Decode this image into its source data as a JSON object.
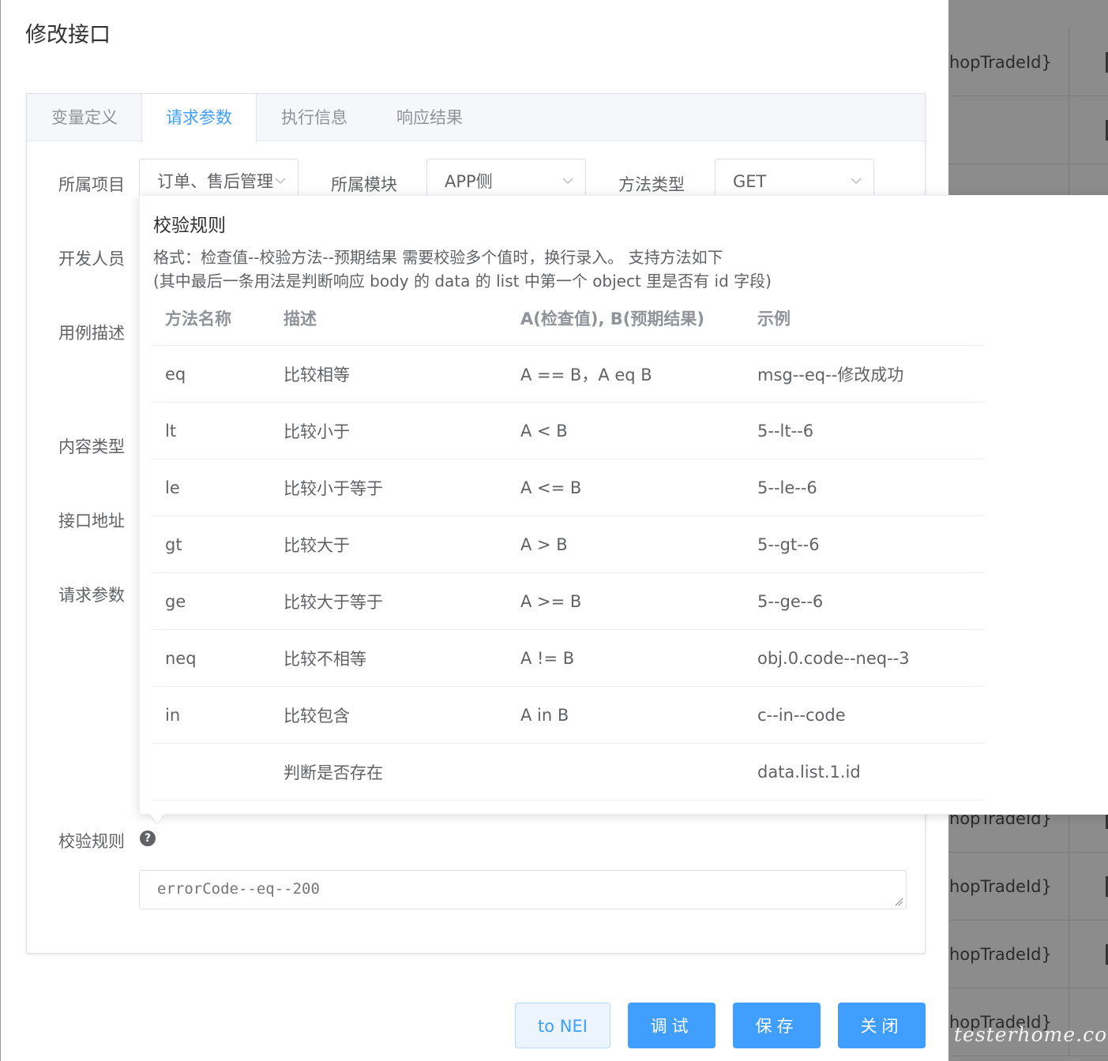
{
  "dialog": {
    "title": "修改接口",
    "tabs": [
      "变量定义",
      "请求参数",
      "执行信息",
      "响应结果"
    ],
    "active_tab": "请求参数"
  },
  "form": {
    "project_label": "所属项目",
    "project_value": "订单、售后管理",
    "module_label": "所属模块",
    "module_value": "APP侧",
    "method_label": "方法类型",
    "method_value": "GET",
    "developer_label": "开发人员",
    "case_desc_label": "用例描述",
    "content_type_label": "内容类型",
    "url_label": "接口地址",
    "params_label": "请求参数",
    "rules_label": "校验规则",
    "rules_placeholder": "errorCode--eq--200"
  },
  "popover": {
    "title": "校验规则",
    "desc_line1": "格式：检查值--校验方法--预期结果 需要校验多个值时，换行录入。 支持方法如下",
    "desc_line2": "(其中最后一条用法是判断响应 body 的 data 的 list 中第一个 object 里是否有 id 字段)",
    "columns": [
      "方法名称",
      "描述",
      "A(检查值), B(预期结果)",
      "示例"
    ],
    "rows": [
      [
        "eq",
        "比较相等",
        "A == B，A eq B",
        "msg--eq--修改成功"
      ],
      [
        "lt",
        "比较小于",
        "A < B",
        "5--lt--6"
      ],
      [
        "le",
        "比较小于等于",
        "A <= B",
        "5--le--6"
      ],
      [
        "gt",
        "比较大于",
        "A > B",
        "5--gt--6"
      ],
      [
        "ge",
        "比较大于等于",
        "A >= B",
        "5--ge--6"
      ],
      [
        "neq",
        "比较不相等",
        "A != B",
        "obj.0.code--neq--3"
      ],
      [
        "in",
        "比较包含",
        "A in B",
        "c--in--code"
      ],
      [
        "",
        "判断是否存在",
        "",
        "data.list.1.id"
      ]
    ]
  },
  "buttons": {
    "to_nei": "to NEI",
    "debug": "调试",
    "save": "保存",
    "close": "关闭"
  },
  "background": {
    "cells": [
      "hopTradeId}",
      "",
      "",
      "",
      "",
      "",
      "",
      "",
      "",
      "",
      "",
      "hopTradeId}",
      "hopTradeId}",
      "hopTradeId}",
      "hopTradeId}"
    ]
  },
  "watermark": "testerhome.com",
  "colors": {
    "primary": "#409eff",
    "border": "#dcdfe6",
    "text": "#606266",
    "overlay": "#8c8c8c"
  }
}
